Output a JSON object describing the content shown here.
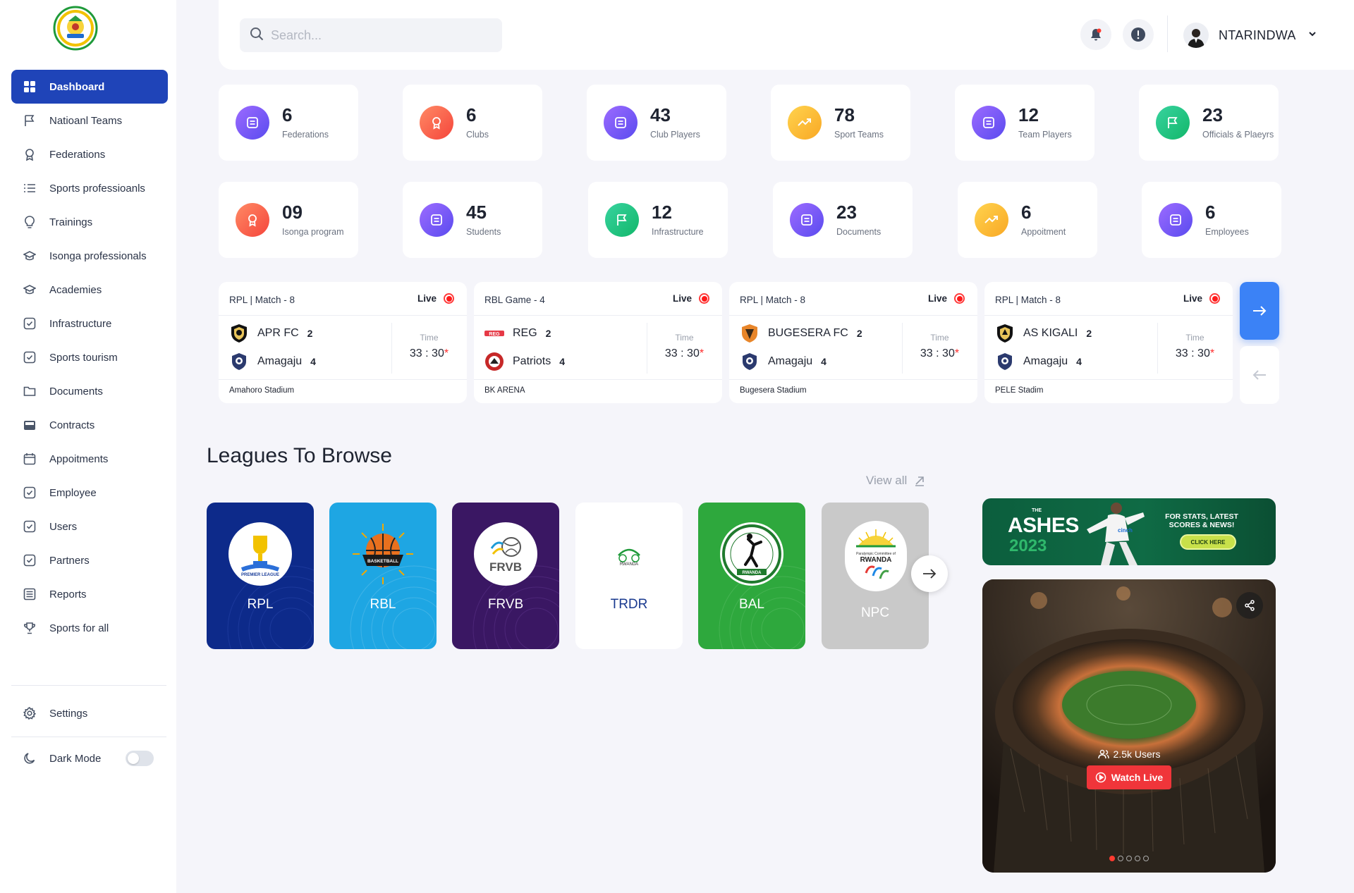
{
  "sidebar": {
    "items": [
      {
        "label": "Dashboard",
        "icon": "grid-icon"
      },
      {
        "label": "Natioanl Teams",
        "icon": "flag-icon"
      },
      {
        "label": "Federations",
        "icon": "award-icon"
      },
      {
        "label": "Sports professioanls",
        "icon": "list-icon"
      },
      {
        "label": "Trainings",
        "icon": "lightbulb-icon"
      },
      {
        "label": "Isonga professionals",
        "icon": "graduation-cap-icon"
      },
      {
        "label": "Academies",
        "icon": "graduation-cap-icon"
      },
      {
        "label": "Infrastructure",
        "icon": "check-square-icon"
      },
      {
        "label": "Sports tourism",
        "icon": "check-square-icon"
      },
      {
        "label": "Documents",
        "icon": "folder-icon"
      },
      {
        "label": "Contracts",
        "icon": "inbox-icon"
      },
      {
        "label": "Appoitments",
        "icon": "calendar-icon"
      },
      {
        "label": "Employee",
        "icon": "check-square-icon"
      },
      {
        "label": "Users",
        "icon": "check-square-icon"
      },
      {
        "label": "Partners",
        "icon": "check-square-icon"
      },
      {
        "label": "Reports",
        "icon": "report-icon"
      },
      {
        "label": "Sports for all",
        "icon": "trophy-icon"
      }
    ],
    "settings_label": "Settings",
    "dark_mode_label": "Dark Mode",
    "dark_mode_on": false
  },
  "header": {
    "search_placeholder": "Search...",
    "username": "NTARINDWA"
  },
  "stats": [
    {
      "value": "6",
      "label": "Federations",
      "color": "purple"
    },
    {
      "value": "6",
      "label": "Clubs",
      "color": "red"
    },
    {
      "value": "43",
      "label": "Club Players",
      "color": "purple"
    },
    {
      "value": "78",
      "label": "Sport Teams",
      "color": "yellow"
    },
    {
      "value": "12",
      "label": "Team Players",
      "color": "purple"
    },
    {
      "value": "23",
      "label": "Officials & Plaeyrs",
      "color": "green"
    },
    {
      "value": "09",
      "label": "Isonga program",
      "color": "red"
    },
    {
      "value": "45",
      "label": "Students",
      "color": "purple"
    },
    {
      "value": "12",
      "label": "Infrastructure",
      "color": "green"
    },
    {
      "value": "23",
      "label": "Documents",
      "color": "purple"
    },
    {
      "value": "6",
      "label": "Appoitment",
      "color": "yellow"
    },
    {
      "value": "6",
      "label": "Employees",
      "color": "purple"
    }
  ],
  "matches": [
    {
      "title": "RPL | Match - 8",
      "live": "Live",
      "home": "APR FC",
      "home_score": "2",
      "away": "Amagaju",
      "away_score": "4",
      "time_label": "Time",
      "time": "33 : 30",
      "venue": "Amahoro Stadium"
    },
    {
      "title": "RBL Game - 4",
      "live": "Live",
      "home": "REG",
      "home_score": "2",
      "away": "Patriots",
      "away_score": "4",
      "time_label": "Time",
      "time": "33 : 30",
      "venue": "BK ARENA"
    },
    {
      "title": "RPL | Match - 8",
      "live": "Live",
      "home": "BUGESERA FC",
      "home_score": "2",
      "away": "Amagaju",
      "away_score": "4",
      "time_label": "Time",
      "time": "33 : 30",
      "venue": "Bugesera Stadium"
    },
    {
      "title": "RPL | Match - 8",
      "live": "Live",
      "home": "AS KIGALI",
      "home_score": "2",
      "away": "Amagaju",
      "away_score": "4",
      "time_label": "Time",
      "time": "33 : 30",
      "venue": "PELE Stadim"
    }
  ],
  "leagues": {
    "heading": "Leagues To Browse",
    "view_all": "View all",
    "items": [
      {
        "name": "RPL",
        "badge_text": "RWANDA PREMIER LEAGUE",
        "bg": "#0d2a8a"
      },
      {
        "name": "RBL",
        "badge_text": "RWANDA BASKETBALL LEAGUE",
        "bg": "#1ea6e3"
      },
      {
        "name": "FRVB",
        "badge_text": "FRVB",
        "bg": "#3a1763"
      },
      {
        "name": "TRDR",
        "badge_text": "TOUR du RWANDA",
        "bg": "#ffffff"
      },
      {
        "name": "BAL",
        "badge_text": "FERWAHAND RWANDA",
        "bg": "#2ea83d"
      },
      {
        "name": "NPC",
        "badge_text": "Paralympic Committee of RWANDA",
        "bg": "#c9c9c9"
      }
    ]
  },
  "ad": {
    "the": "THE",
    "title": "ASHES",
    "year": "2023",
    "text": "FOR STATS, LATEST SCORES & NEWS!",
    "cta": "CLICK HERE",
    "brand": "cinch"
  },
  "video": {
    "users": "2.5k Users",
    "watch_label": "Watch Live",
    "slide_count": 5,
    "active_slide": 1
  },
  "colors": {
    "accent": "#1f44b8",
    "live_red": "#ff1a1a",
    "next_blue": "#3b82f6"
  }
}
